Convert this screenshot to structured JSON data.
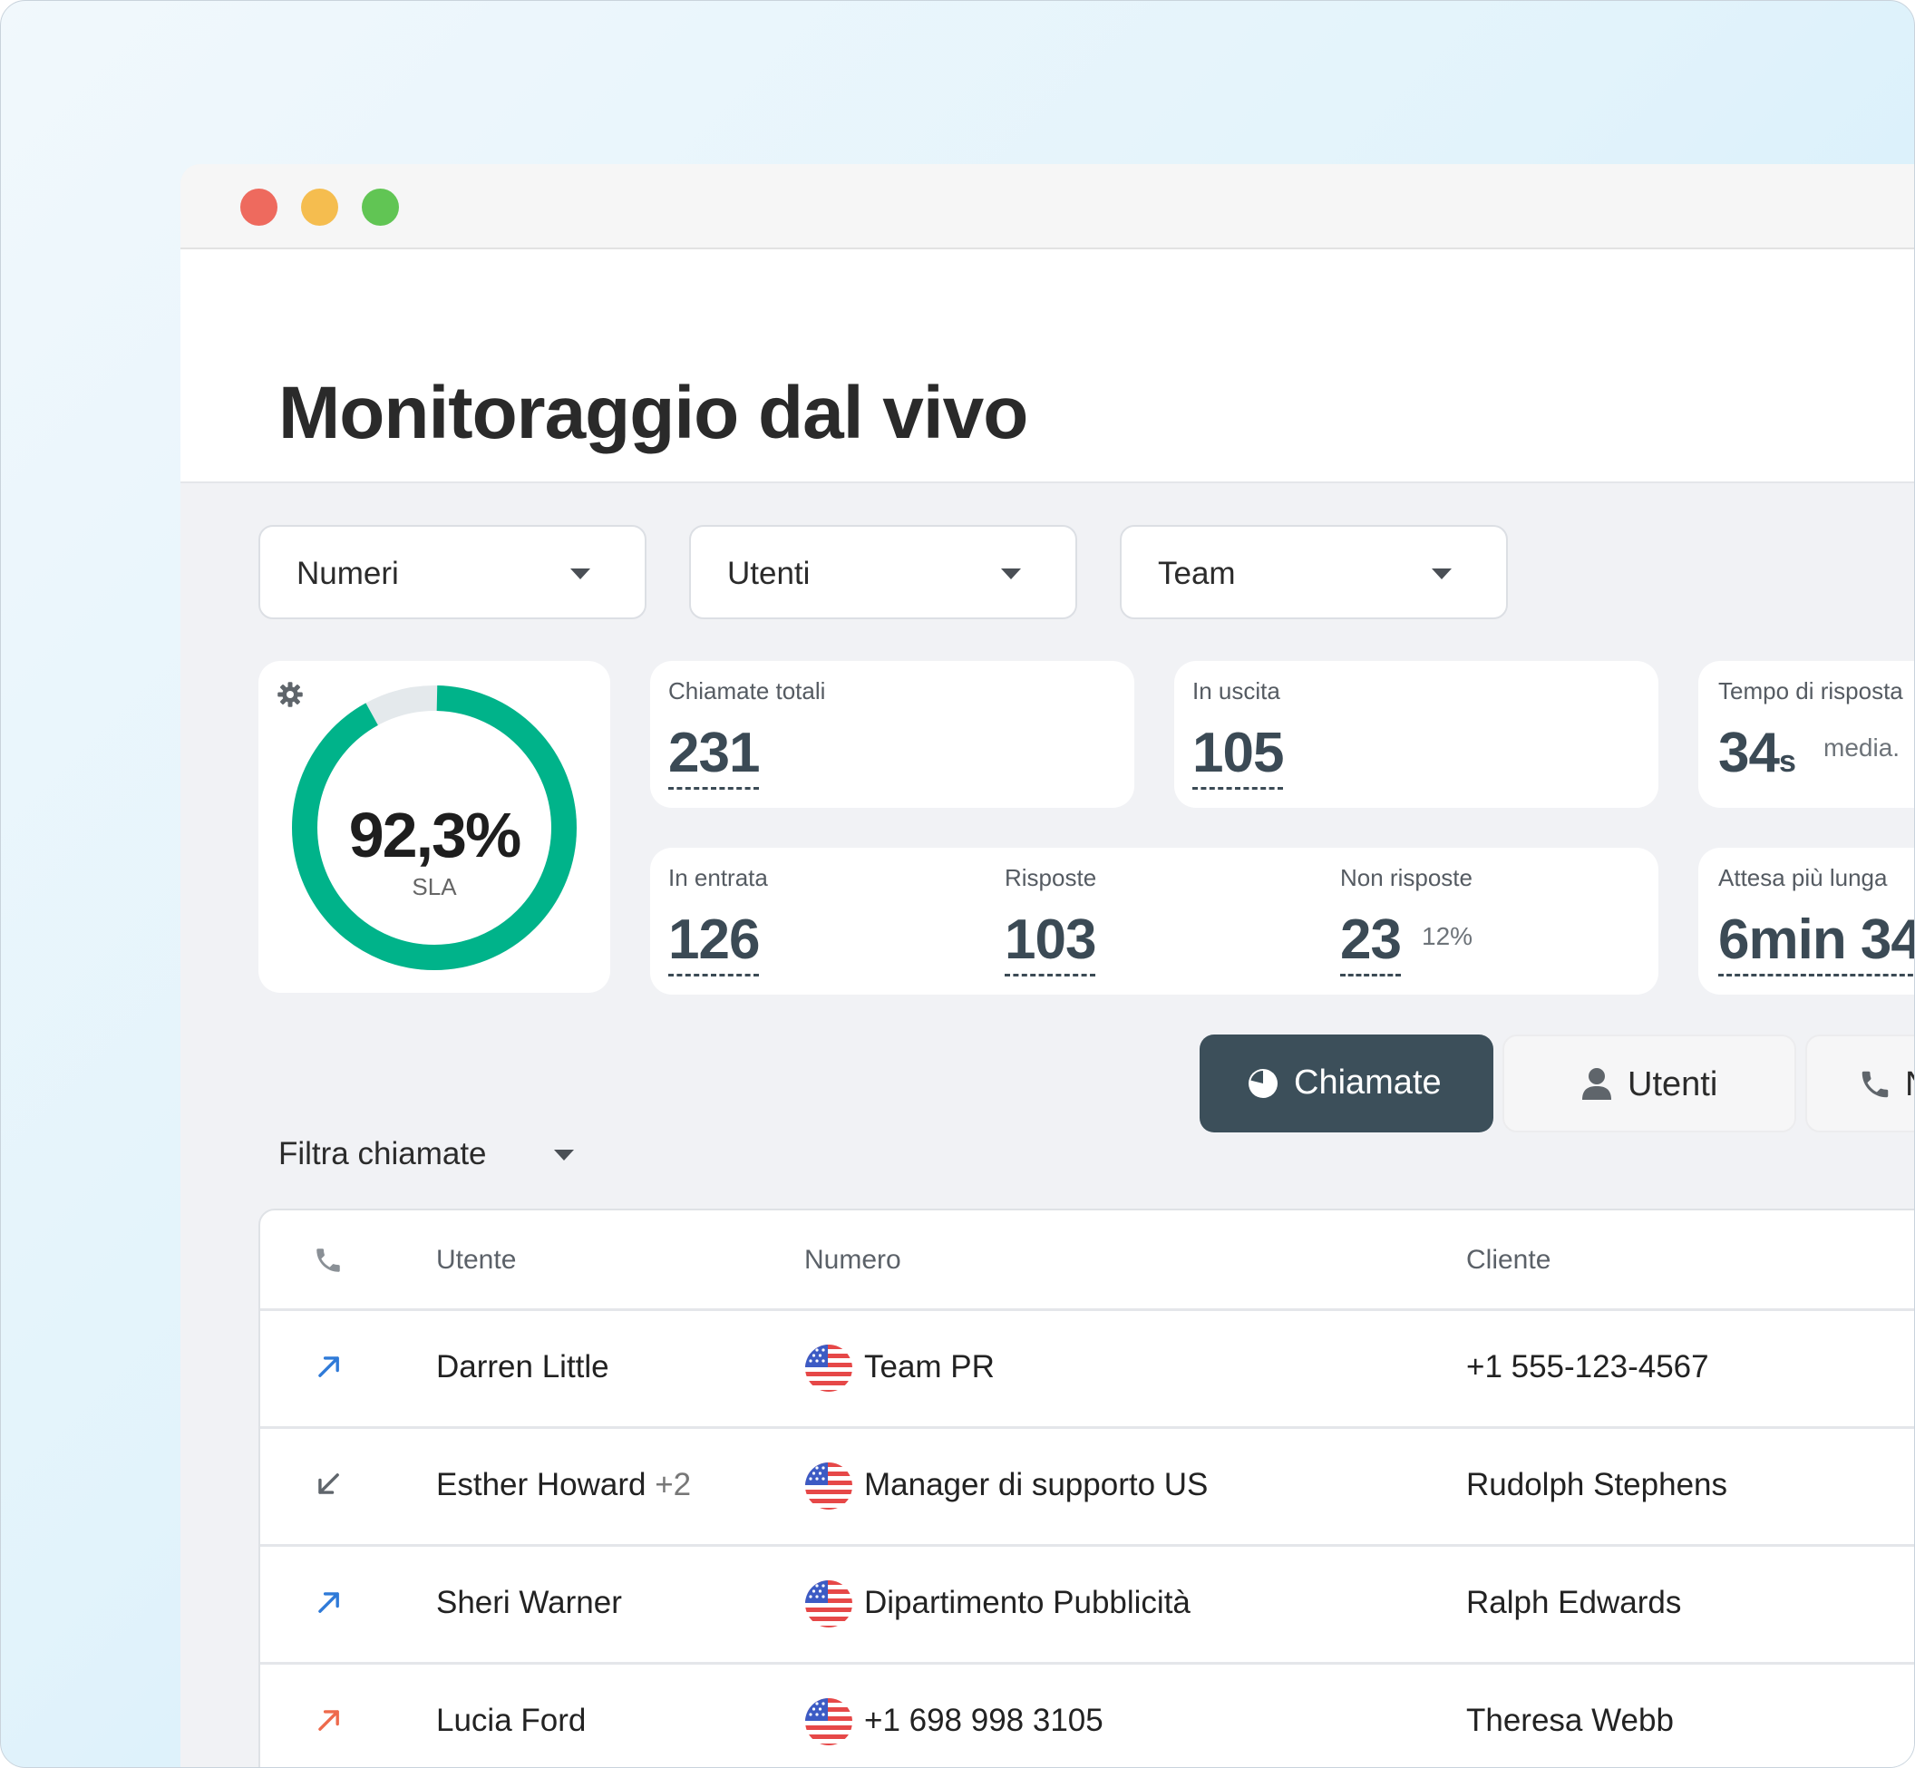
{
  "page": {
    "title": "Monitoraggio dal vivo"
  },
  "filters": [
    {
      "label": "Numeri"
    },
    {
      "label": "Utenti"
    },
    {
      "label": "Team"
    }
  ],
  "sla": {
    "value": "92,3%",
    "label": "SLA",
    "percent": 92.3
  },
  "stats": {
    "total": {
      "caption": "Chiamate totali",
      "value": "231"
    },
    "outgoing": {
      "caption": "In uscita",
      "value": "105"
    },
    "response_time": {
      "caption": "Tempo di risposta",
      "value": "34",
      "unit": "s",
      "suffix": "media."
    },
    "incoming": {
      "caption": "In entrata",
      "value": "126"
    },
    "answered": {
      "caption": "Risposte",
      "value": "103"
    },
    "unanswered": {
      "caption": "Non risposte",
      "value": "23",
      "percent": "12%"
    },
    "longest_wait": {
      "caption": "Attesa più lunga",
      "value": "6min 34"
    }
  },
  "tabs": [
    {
      "label": "Chiamate",
      "icon": "pie-chart-icon",
      "active": true
    },
    {
      "label": "Utenti",
      "icon": "user-icon",
      "active": false
    },
    {
      "label": "N",
      "icon": "phone-icon",
      "active": false
    }
  ],
  "call_filter": {
    "label": "Filtra chiamate"
  },
  "table": {
    "headers": [
      "Utente",
      "Numero",
      "Cliente"
    ],
    "rows": [
      {
        "direction": "outgoing",
        "user": "Darren Little",
        "extra": "",
        "number": "Team PR",
        "client": "+1 555-123-4567"
      },
      {
        "direction": "incoming",
        "user": "Esther Howard",
        "extra": "+2",
        "number": "Manager di supporto US",
        "client": "Rudolph Stephens"
      },
      {
        "direction": "outgoing",
        "user": "Sheri Warner",
        "extra": "",
        "number": "Dipartimento Pubblicità",
        "client": "Ralph Edwards"
      },
      {
        "direction": "missed",
        "user": "Lucia Ford",
        "extra": "",
        "number": "+1 698 998 3105",
        "client": "Theresa Webb"
      }
    ]
  },
  "colors": {
    "accent": "#00b38a",
    "track": "#e4e9ec",
    "active_tab": "#3c4f5a",
    "outgoing_arrow": "#2f7ad8",
    "incoming_arrow": "#5f656b",
    "missed_arrow": "#ee6a4c"
  }
}
